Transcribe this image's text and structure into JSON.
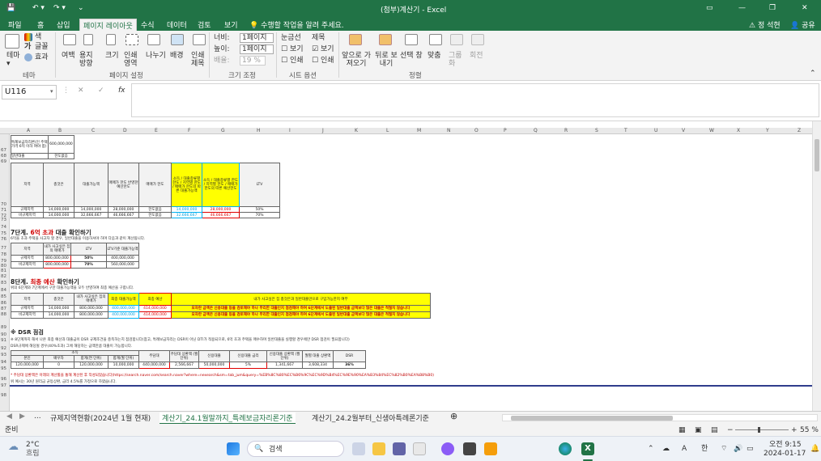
{
  "titlebar": {
    "autosave": "저장",
    "title": "(첨부)계산기 - Excel",
    "user": "정 석현",
    "share": "공유"
  },
  "tabs": [
    "파일",
    "홈",
    "삽입",
    "페이지 레이아웃",
    "수식",
    "데이터",
    "검토",
    "보기"
  ],
  "tellme": "수행할 작업을 알려 주세요.",
  "ribbon": {
    "theme": [
      "테마",
      "색",
      "글꼴",
      "효과"
    ],
    "theme_group": "테마",
    "page_setup": [
      "여백",
      "용지 방향",
      "크기",
      "인쇄 영역",
      "나누기",
      "배경",
      "인쇄 제목"
    ],
    "page_setup_group": "페이지 설정",
    "scale": {
      "width_label": "너비:",
      "width_val": "1페이지",
      "height_label": "높이:",
      "height_val": "1페이지",
      "scale_label": "배율:",
      "scale_val": "19 %"
    },
    "scale_group": "크기 조정",
    "sheet_opts": {
      "gridlines": "눈금선",
      "headings": "제목",
      "view1": "보기",
      "view2": "보기",
      "print1": "인쇄",
      "print2": "인쇄"
    },
    "sheet_group": "시트 옵션",
    "arrange": [
      "앞으로 가져오기",
      "뒤로 보내기",
      "선택 창",
      "맞춤",
      "그룹화",
      "회전"
    ],
    "arrange_group": "정렬"
  },
  "formula": {
    "namebox": "U116",
    "cancel": "✕",
    "enter": "✓",
    "fx": "fx",
    "value": ""
  },
  "columns": [
    "A",
    "B",
    "C",
    "D",
    "E",
    "F",
    "G",
    "H",
    "I",
    "J",
    "K",
    "L",
    "M",
    "N",
    "O",
    "P",
    "Q",
    "R",
    "S",
    "T",
    "U",
    "V",
    "W",
    "X",
    "Y",
    "Z",
    "AA",
    "AB",
    "AC",
    "AD",
    "AE"
  ],
  "rows": [
    "67",
    "68",
    "69",
    "70",
    "71",
    "72",
    "73",
    "74",
    "75",
    "76",
    "77",
    "78",
    "79",
    "80",
    "81",
    "82",
    "83",
    "84",
    "85",
    "86",
    "87",
    "88",
    "89",
    "90",
    "91",
    "92",
    "93",
    "94",
    "95",
    "96",
    "97",
    "98"
  ],
  "sheet": {
    "top_box": {
      "label": "특례보금자리론(인 주택가격 6억 이하 여야 함)",
      "value": "600,000,000",
      "label2": "일반대출",
      "value2": "한도없음"
    },
    "t1": {
      "headers": [
        "지역",
        "총것은",
        "대출가능액",
        "매매가 한도 반영한 예산한도",
        "매매가 한도",
        "소득 / 대출종류별 한도 / 지역별 한도 / 매매가 한도의 따른 대출가능액",
        "소득 / 대출종류별 한도 / 지역별 한도 / 매매가 한도의 따른 예산한도",
        "LTV"
      ],
      "rows": [
        [
          "규제지역",
          "14,000,000",
          "14,000,000",
          "28,000,000",
          "한도없음",
          "14,000,000",
          "28,000,000",
          "50%"
        ],
        [
          "비규제지역",
          "14,000,000",
          "32,666,667",
          "46,666,667",
          "한도없음",
          "32,666,667",
          "46,666,667",
          "70%"
        ]
      ]
    },
    "step7": {
      "title_a": "7단계. ",
      "title_b": "6억 초과",
      "title_c": " 대출 확인하기",
      "note": "6억을 초과 주택을 사고자 할 경우, 일반대출을 이용하셔야 하며 다음과 같이 계산됩니다.",
      "headers": [
        "지역",
        "내가 사고싶은 집의 매매가",
        "LTV",
        "LTV기준 대출가능액"
      ],
      "rows": [
        [
          "규제지역",
          "800,000,000",
          "50%",
          "400,000,000"
        ],
        [
          "비규제지역",
          "800,000,000",
          "70%",
          "560,000,000"
        ]
      ]
    },
    "step8": {
      "title_a": "8단계. ",
      "title_b": "최종 예산",
      "title_c": " 확인하기",
      "note": "위의 6단계와 7단계에서 구한 대출가능액을 모두 반영하여 최종 예산을 구합니다.",
      "headers": [
        "지역",
        "총것은",
        "내가 사고싶은 집의 매매가",
        "최종 대출가능액",
        "최종 예산",
        "내가 사고싶은 집 총것은과 일반대출만으로 구입가능한지 여부"
      ],
      "rows": [
        [
          "규제지역",
          "14,000,000",
          "800,000,000",
          "400,000,000",
          "414,000,000",
          "모자란 금액은 신용대출 등을 검토해야 하나 무리한 대출인지 점검해야 하며 6단계에서 도출된 일반대출 금액보다 많은 대출은 적절치 않습니다"
        ],
        [
          "비규제지역",
          "14,000,000",
          "800,000,000",
          "400,000,000",
          "414,000,000",
          "모자란 금액은 신용대출 등을 검토해야 하나 무리한 대출인지 점검해야 하며 6단계에서 도출된 일반대출 금액보다 많은 대출은 적절치 않습니다"
        ]
      ]
    },
    "dsr": {
      "title": "※ DSR 점검",
      "note1": "※ 8단계까지 해서 나온 최종 예산과 대출금이 DSR 규제조건을 충족하는지 점검합니다(참고, 특례보금자리는 DSR이 아닌 DTI가 적용되므로, 6억 초과 주택을 매수하며 일반대출을 실행할 경우에만 DSR 점검이 필요합니다)",
      "note2": "DSR규제에 해당될 경우(40%초과) 그에 해당하는 금액만큼 대출이 가능합니다.",
      "headers_top": "소득",
      "headers": [
        "본인",
        "배우자",
        "합계(연 단위)",
        "합계(월 단위)",
        "주담대",
        "주담대 상환액 (월 단위)",
        "신용대출",
        "신용대출 금리",
        "신용대출 상환액 (월 단위)",
        "월별 대출 상환액",
        "DSR"
      ],
      "row": [
        "120,000,000",
        "0",
        "120,000,000",
        "10,000,000",
        "440,000,000",
        "2,566,667",
        "50,000,000",
        "5%",
        "1,341,667",
        "3,608,334",
        "36%"
      ],
      "foot1": "* 주담대 상환액은 아래의 계산툴을 통해 계산된 후 작성되었습니다(https://search.naver.com/search.naver?where=nexearch&sm=tab_jum&query=%EB%8C%80%EC%B6%9C%EC%9D%B4%EC%9E%90%EA%B3%84%EC%82%B0%EA%B8%B0)",
      "foot2": "위 예시는 30년 원리금 균등상환, 금리 4.5%를 가정으로 하였습니다."
    }
  },
  "sheettabs": [
    "...",
    "규제지역현황(2024년 1월 현재)",
    "계산기_24.1월말까지_특례보금자리론기준",
    "계산기_24.2월부터_신생아특례론기준"
  ],
  "status": {
    "ready": "준비",
    "zoom": "55 %"
  },
  "taskbar": {
    "temp": "2°C",
    "weather": "흐림",
    "search": "검색",
    "time": "오전 9:15",
    "date": "2024-01-17",
    "lang": "한"
  }
}
